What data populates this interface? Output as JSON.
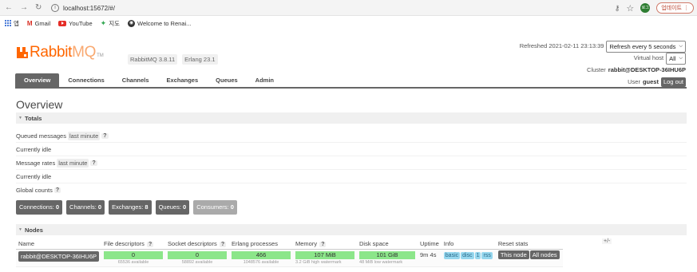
{
  "browser": {
    "url": "localhost:15672/#/",
    "update_label": "업데이트",
    "profile": "로그",
    "bookmarks": [
      {
        "label": "앱",
        "icon": "apps-icon"
      },
      {
        "label": "Gmail",
        "icon": "gmail-icon"
      },
      {
        "label": "YouTube",
        "icon": "youtube-icon"
      },
      {
        "label": "지도",
        "icon": "maps-icon"
      },
      {
        "label": "Welcome to Renai...",
        "icon": "globe-icon"
      }
    ]
  },
  "header": {
    "logo_text_a": "Rabbit",
    "logo_text_b": "MQ",
    "logo_tm": "TM",
    "version_label": "RabbitMQ 3.8.11",
    "erlang_label": "Erlang 23.1",
    "refreshed_text": "Refreshed 2021-02-11 23:13:39",
    "refresh_select": "Refresh every 5 seconds",
    "vhost_label": "Virtual host",
    "vhost_select": "All",
    "cluster_label": "Cluster",
    "cluster_name": "rabbit@DESKTOP-36IHU6P",
    "user_label": "User",
    "user_name": "guest",
    "logout_label": "Log out"
  },
  "tabs": [
    {
      "label": "Overview",
      "active": true
    },
    {
      "label": "Connections",
      "active": false
    },
    {
      "label": "Channels",
      "active": false
    },
    {
      "label": "Exchanges",
      "active": false
    },
    {
      "label": "Queues",
      "active": false
    },
    {
      "label": "Admin",
      "active": false
    }
  ],
  "page_title": "Overview",
  "totals": {
    "heading": "Totals",
    "queued_label": "Queued messages",
    "queued_chip": "last minute",
    "help": "?",
    "idle_1": "Currently idle",
    "rates_label": "Message rates",
    "rates_chip": "last minute",
    "idle_2": "Currently idle",
    "global_label": "Global counts"
  },
  "counts": {
    "connections_label": "Connections:",
    "connections": "0",
    "channels_label": "Channels:",
    "channels": "0",
    "exchanges_label": "Exchanges:",
    "exchanges": "8",
    "queues_label": "Queues:",
    "queues": "0",
    "consumers_label": "Consumers:",
    "consumers": "0"
  },
  "nodes": {
    "heading": "Nodes",
    "plus_minus": "+/-",
    "columns": [
      "Name",
      "File descriptors",
      "Socket descriptors",
      "Erlang processes",
      "Memory",
      "Disk space",
      "Uptime",
      "Info",
      "Reset stats"
    ],
    "row": {
      "name": "rabbit@DESKTOP-36IHU6P",
      "file_descriptors": "0",
      "file_available": "65536 available",
      "socket_descriptors": "0",
      "socket_available": "58892 available",
      "erlang_processes": "466",
      "erlang_available": "1048576 available",
      "memory": "107 MiB",
      "memory_watermark": "3.2 GiB high watermark",
      "disk": "101 GiB",
      "disk_watermark": "48 MiB low watermark",
      "uptime": "9m 4s",
      "info_basic": "basic",
      "info_disc": "disc",
      "info_1": "1",
      "info_rss": "rss",
      "reset_this": "This node",
      "reset_all": "All nodes"
    }
  },
  "colors": {
    "brand": "#ff6600",
    "tab_active": "#666666",
    "bar_green": "#8ce68a",
    "badge_blue": "#96d7ee"
  }
}
